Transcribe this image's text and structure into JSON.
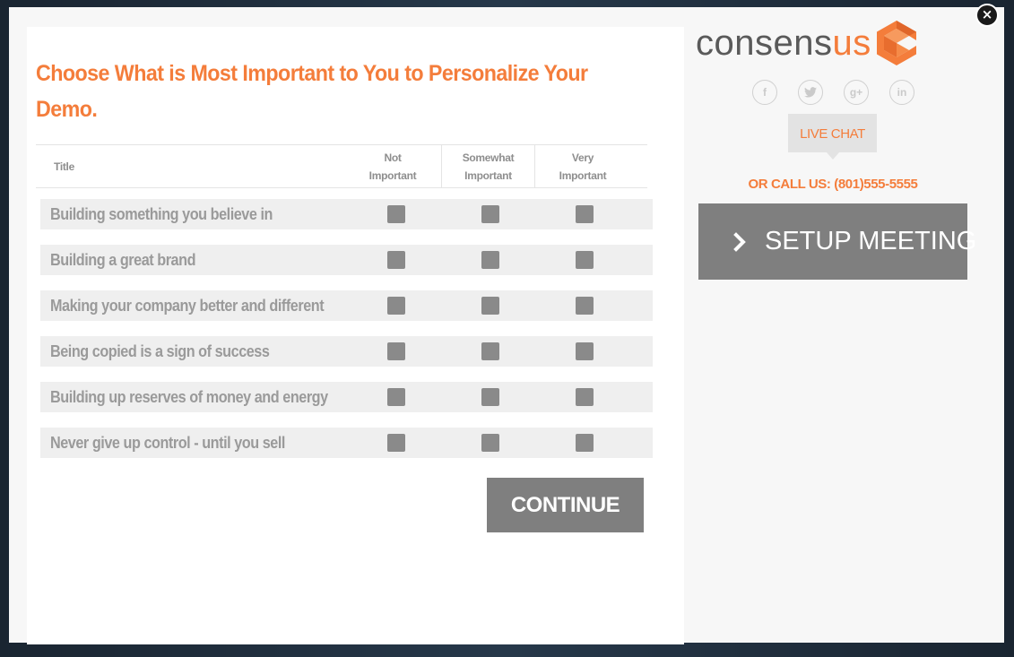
{
  "modal": {
    "close_glyph": "×",
    "heading": "Choose What is Most Important to You to Personalize Your Demo.",
    "table": {
      "headers": {
        "title": "Title",
        "col1": "Not Important",
        "col2": "Somewhat Important",
        "col3": "Very Important"
      },
      "rows": [
        {
          "label": "Building something you believe in"
        },
        {
          "label": "Building a great brand"
        },
        {
          "label": "Making your company better and different"
        },
        {
          "label": "Being copied is a sign of success"
        },
        {
          "label": "Building up reserves of money and energy"
        },
        {
          "label": "Never give up control - until you sell"
        }
      ]
    },
    "continue_label": "CONTINUE"
  },
  "sidebar": {
    "logo": {
      "text_main": "consens",
      "text_accent": "us"
    },
    "social": [
      {
        "icon": "facebook-icon",
        "glyph": "f"
      },
      {
        "icon": "twitter-icon",
        "glyph": "t"
      },
      {
        "icon": "google-plus-icon",
        "glyph": "g+"
      },
      {
        "icon": "linkedin-icon",
        "glyph": "in"
      }
    ],
    "live_chat_label": "LIVE CHAT",
    "call_us": "OR CALL US: (801)555-5555",
    "setup_meeting_label": "SETUP MEETING"
  },
  "colors": {
    "accent": "#f47d3b",
    "button_gray": "#7f7f7f",
    "row_bg": "#efefef",
    "checkbox": "#8a8a8a"
  }
}
